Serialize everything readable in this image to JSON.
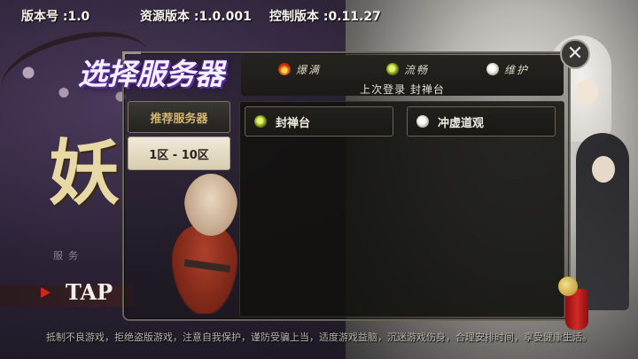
{
  "topbar": {
    "version": "版本号 :1.0",
    "resource_version": "资源版本 :1.0.001",
    "control_version": "控制版本 :0.11.27"
  },
  "background": {
    "title_glyph": "妖",
    "subtitle": "服务",
    "tap_text": "TAP"
  },
  "dialog": {
    "title": "选择服务器",
    "close_symbol": "✕",
    "legend": {
      "hot": "爆满",
      "smooth": "流畅",
      "maintenance": "维护"
    },
    "last_login": "上次登录 封禅台",
    "tabs": {
      "recommended": "推荐服务器",
      "zone_range": "1区 - 10区"
    },
    "servers": [
      {
        "name": "封禅台",
        "status": "smooth"
      },
      {
        "name": "冲虚道观",
        "status": "maintenance"
      }
    ]
  },
  "notice": "抵制不良游戏，拒绝盗版游戏，注意自我保护，谨防受骗上当，适度游戏益脑，沉迷游戏伤身，合理安排时间，享受健康生活。",
  "colors": {
    "accent_gold": "#d2b66d",
    "title_purple": "#5a2e9a",
    "status_hot": "#f07a1a",
    "status_smooth": "#9ab51e",
    "status_maintenance": "#e8e4da"
  }
}
